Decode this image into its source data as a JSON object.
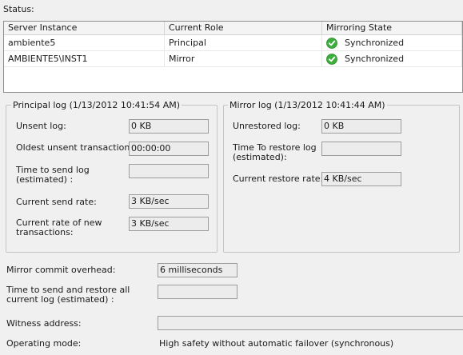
{
  "status_label": "Status:",
  "grid": {
    "headers": [
      "Server Instance",
      "Current Role",
      "Mirroring State"
    ],
    "rows": [
      {
        "server": "ambiente5",
        "role": "Principal",
        "state": "Synchronized"
      },
      {
        "server": "AMBIENTE5\\INST1",
        "role": "Mirror",
        "state": "Synchronized"
      }
    ]
  },
  "principal_log": {
    "title": "Principal log (1/13/2012 10:41:54 AM)",
    "unsent_log_label": "Unsent log:",
    "unsent_log_value": "0 KB",
    "oldest_unsent_label": "Oldest unsent transaction:",
    "oldest_unsent_value": "00:00:00",
    "time_to_send_label": "Time to send log (estimated) :",
    "time_to_send_value": "",
    "send_rate_label": "Current send rate:",
    "send_rate_value": "3 KB/sec",
    "new_tx_rate_label": "Current rate of new transactions:",
    "new_tx_rate_value": "3 KB/sec"
  },
  "mirror_log": {
    "title": "Mirror log (1/13/2012 10:41:44 AM)",
    "unrestored_label": "Unrestored log:",
    "unrestored_value": "0 KB",
    "time_to_restore_label": "Time To restore log (estimated):",
    "time_to_restore_value": "",
    "restore_rate_label": "Current restore rate:",
    "restore_rate_value": "4 KB/sec"
  },
  "commit_overhead_label": "Mirror commit overhead:",
  "commit_overhead_value": "6 milliseconds",
  "time_send_restore_label": "Time to send and restore all current log (estimated) :",
  "time_send_restore_value": "",
  "witness_label": "Witness address:",
  "witness_value": "",
  "operating_mode_label": "Operating mode:",
  "operating_mode_value": "High safety without automatic failover (synchronous)",
  "colors": {
    "ok_green": "#3cae3c"
  },
  "icons": {
    "state": "check-circle-icon"
  }
}
